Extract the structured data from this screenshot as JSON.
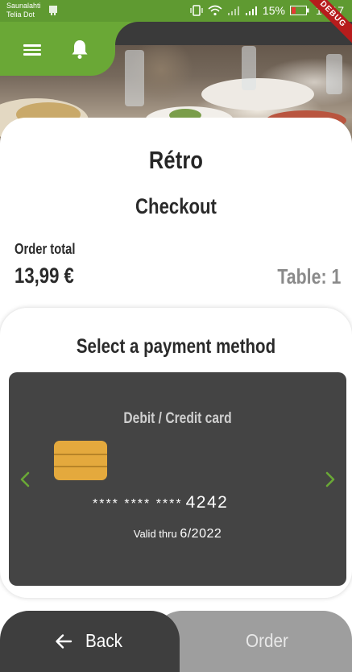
{
  "status_bar": {
    "carrier_line1": "Saunalahti",
    "carrier_line2": "Telia Dot",
    "battery_percent": "15%",
    "time": "16:17",
    "debug_label": "DEBUG"
  },
  "header": {
    "menu_icon": "hamburger-menu-icon",
    "notifications_icon": "bell-icon",
    "accent_color": "#6aa836"
  },
  "main": {
    "restaurant_name": "Rétro",
    "page_title": "Checkout",
    "order_total_label": "Order total",
    "order_total_value": "13,99 €",
    "table_label": "Table: 1"
  },
  "payment": {
    "heading": "Select a payment method",
    "card": {
      "type": "Debit / Credit card",
      "masked_digits": "**** **** ****",
      "last4": "4242",
      "valid_label": "Valid thru",
      "valid_date": "6/2022"
    },
    "prev_icon": "chevron-left-icon",
    "next_icon": "chevron-right-icon"
  },
  "bottom_bar": {
    "back_label": "Back",
    "order_label": "Order"
  }
}
